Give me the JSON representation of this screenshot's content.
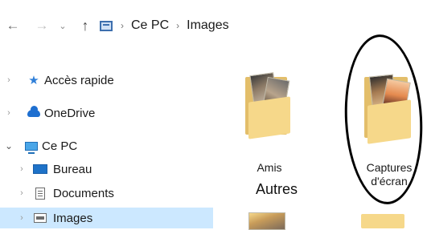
{
  "address_bar": {
    "back_icon": "←",
    "forward_icon": "→",
    "recent_icon": "⌄",
    "up_icon": "↑",
    "separator": "›",
    "crumbs": [
      "Ce PC",
      "Images"
    ]
  },
  "nav": {
    "items": [
      {
        "label": "Accès rapide",
        "icon": "star-icon",
        "chevron": "›"
      },
      {
        "label": "OneDrive",
        "icon": "cloud-icon",
        "chevron": "›"
      },
      {
        "label": "Ce PC",
        "icon": "computer-icon",
        "chevron": "⌄"
      },
      {
        "label": "Bureau",
        "icon": "desktop-icon",
        "chevron": "›"
      },
      {
        "label": "Documents",
        "icon": "documents-icon",
        "chevron": "›"
      },
      {
        "label": "Images",
        "icon": "images-icon",
        "chevron": "›",
        "selected": true
      }
    ]
  },
  "content": {
    "folders": [
      {
        "label": "Amis"
      },
      {
        "label": "Captures d'écran",
        "line1": "Captures",
        "line2": "d'écran"
      }
    ],
    "annotation": "Autres"
  },
  "colors": {
    "selection": "#cce8ff",
    "folder": "#f6d88a",
    "folder_back": "#e3be6a"
  }
}
